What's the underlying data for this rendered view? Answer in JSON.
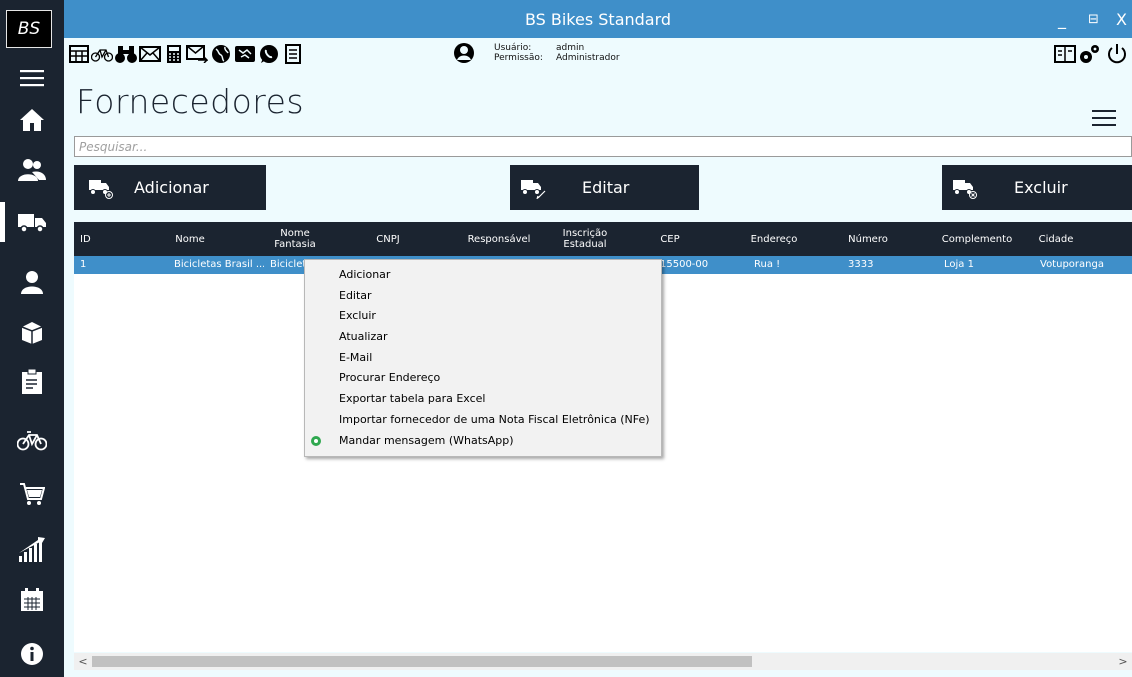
{
  "app": {
    "logo": "BS",
    "title": "BS Bikes Standard",
    "window_controls": [
      "_",
      "⊟",
      "X"
    ]
  },
  "sidebar": {
    "items": [
      {
        "icon": "menu-icon"
      },
      {
        "icon": "home-icon"
      },
      {
        "icon": "clients-icon"
      },
      {
        "icon": "suppliers-truck-icon",
        "active": true
      },
      {
        "icon": "user-icon"
      },
      {
        "icon": "products-box-icon"
      },
      {
        "icon": "clipboard-icon"
      },
      {
        "icon": "bicycle-icon"
      },
      {
        "icon": "cart-icon"
      },
      {
        "icon": "reports-chart-icon"
      },
      {
        "icon": "calendar-icon"
      },
      {
        "icon": "info-icon"
      }
    ]
  },
  "user": {
    "user_label": "Usuário:",
    "user_value": "admin",
    "perm_label": "Permissão:",
    "perm_value": "Administrador"
  },
  "page": {
    "title": "Fornecedores",
    "search_placeholder": "Pesquisar..."
  },
  "actions": {
    "add": "Adicionar",
    "edit": "Editar",
    "delete": "Excluir"
  },
  "table": {
    "columns": [
      "ID",
      "Nome",
      "Nome Fantasia",
      "CNPJ",
      "Responsável",
      "Inscrição Estadual",
      "CEP",
      "Endereço",
      "Número",
      "Complemento",
      "Cidade"
    ],
    "rows": [
      {
        "id": "1",
        "nome": "Bicicletas Brasil ...",
        "fantasia": "Biciclet",
        "cep": "15500-000",
        "endereco": "Rua !",
        "numero": "3333",
        "complemento": "Loja 1",
        "cidade": "Votuporanga"
      }
    ]
  },
  "context_menu": {
    "items": [
      "Adicionar",
      "Editar",
      "Excluir",
      "Atualizar",
      "E-Mail",
      "Procurar Endereço",
      "Exportar tabela para Excel",
      "Importar fornecedor de uma Nota Fiscal Eletrônica (NFe)",
      "Mandar mensagem (WhatsApp)"
    ]
  },
  "colors": {
    "sidebar": "#1b2430",
    "titlebar": "#3f8fc9",
    "content_bg": "#eefbfe",
    "selected_row": "#3f8fc9",
    "whatsapp": "#2fa84f"
  }
}
